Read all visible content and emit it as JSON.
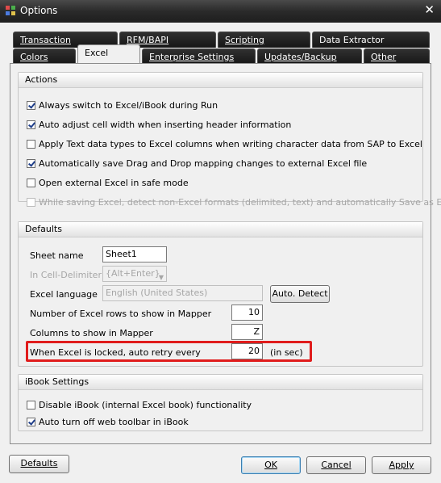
{
  "window": {
    "title": "Options",
    "close_glyph": "✕"
  },
  "tabs_row1": [
    {
      "label": "Transaction"
    },
    {
      "label": "RFM/BAPI"
    },
    {
      "label": "Scripting"
    },
    {
      "label": "Data Extractor"
    }
  ],
  "tabs_row2": [
    {
      "label": "Colors"
    },
    {
      "label": "Excel",
      "active": true
    },
    {
      "label": "Enterprise Settings"
    },
    {
      "label": "Updates/Backup"
    },
    {
      "label": "Other"
    }
  ],
  "actions": {
    "title": "Actions",
    "items": [
      {
        "label": "Always switch to Excel/iBook during Run",
        "checked": true,
        "enabled": true
      },
      {
        "label": "Auto adjust cell width when inserting header information",
        "checked": true,
        "enabled": true
      },
      {
        "label": "Apply Text data types to Excel columns when writing character data from SAP to Excel",
        "checked": false,
        "enabled": true
      },
      {
        "label": "Automatically save Drag and Drop mapping changes to external Excel file",
        "checked": true,
        "enabled": true
      },
      {
        "label": "Open external Excel in safe mode",
        "checked": false,
        "enabled": true
      },
      {
        "label": "While saving Excel, detect non-Excel formats (delimited, text) and automatically Save as Excel",
        "checked": false,
        "enabled": false
      }
    ]
  },
  "defaults": {
    "title": "Defaults",
    "sheet_name_label": "Sheet name",
    "sheet_name_value": "Sheet1",
    "delimiter_label": "In Cell-Delimiter",
    "delimiter_value": "{Alt+Enter}",
    "language_label": "Excel language",
    "language_value": "English (United States)",
    "auto_detect_label": "Auto. Detect",
    "rows_label": "Number of Excel rows to show in Mapper",
    "rows_value": "10",
    "columns_label": "Columns to show in Mapper",
    "columns_value": "Z",
    "retry_label": "When Excel is locked, auto retry every",
    "retry_value": "20",
    "retry_unit": "(in sec)"
  },
  "ibook": {
    "title": "iBook Settings",
    "items": [
      {
        "label": "Disable iBook (internal Excel book) functionality",
        "checked": false
      },
      {
        "label": "Auto turn off web toolbar in iBook",
        "checked": true
      }
    ]
  },
  "buttons": {
    "defaults": "Defaults",
    "ok": "OK",
    "cancel": "Cancel",
    "apply": "Apply"
  },
  "colors": {
    "highlight": "#e01c1c",
    "titlebar": "#2a2a2a",
    "check": "#1e3e8a"
  }
}
